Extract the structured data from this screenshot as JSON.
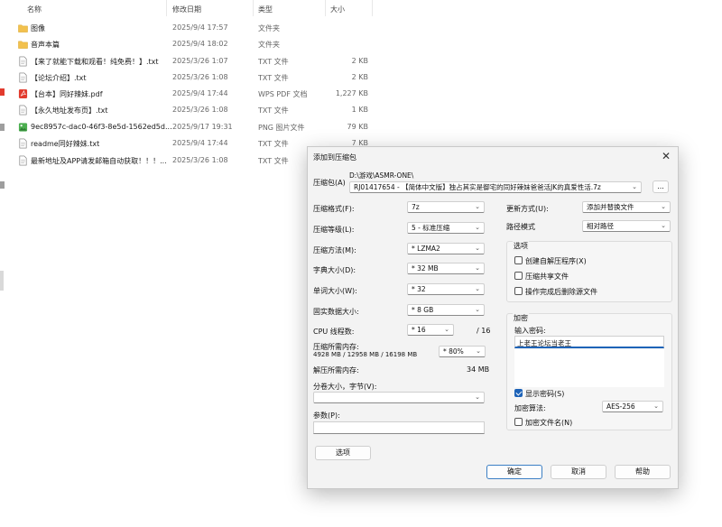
{
  "explorer": {
    "columns": {
      "name": "名称",
      "modified": "修改日期",
      "type": "类型",
      "size": "大小"
    },
    "files": [
      {
        "name": "图像",
        "date": "2025/9/4 17:57",
        "type": "文件夹",
        "size": "",
        "icon": "folder-icon"
      },
      {
        "name": "音声本篇",
        "date": "2025/9/4 18:02",
        "type": "文件夹",
        "size": "",
        "icon": "folder-icon"
      },
      {
        "name": "【来了就能下载和观看！纯免费！】.txt",
        "date": "2025/3/26 1:07",
        "type": "TXT 文件",
        "size": "2 KB",
        "icon": "text-file-icon"
      },
      {
        "name": "【论坛介绍】.txt",
        "date": "2025/3/26 1:08",
        "type": "TXT 文件",
        "size": "2 KB",
        "icon": "text-file-icon"
      },
      {
        "name": "【台本】同好辣妹.pdf",
        "date": "2025/9/4 17:44",
        "type": "WPS PDF 文档",
        "size": "1,227 KB",
        "icon": "pdf-file-icon"
      },
      {
        "name": "【永久地址发布页】.txt",
        "date": "2025/3/26 1:08",
        "type": "TXT 文件",
        "size": "1 KB",
        "icon": "text-file-icon"
      },
      {
        "name": "9ec8957c-dac0-46f3-8e5d-1562ed5d...",
        "date": "2025/9/17 19:31",
        "type": "PNG 图片文件",
        "size": "79 KB",
        "icon": "image-file-icon"
      },
      {
        "name": "readme同好辣妹.txt",
        "date": "2025/9/4 17:44",
        "type": "TXT 文件",
        "size": "7 KB",
        "icon": "text-file-icon"
      },
      {
        "name": "最新地址及APP请发邮箱自动获取！！！...",
        "date": "2025/3/26 1:08",
        "type": "TXT 文件",
        "size": "",
        "icon": "text-file-icon"
      }
    ]
  },
  "dialog": {
    "title": "添加到压缩包",
    "close": "✕",
    "archive": {
      "label": "压缩包(A)",
      "path": "D:\\游戏\\ASMR-ONE\\",
      "filename": "RJ01417654 - 【简体中文版】独占其实是御宅的同好辣妹爸爸活JK的真爱性活.7z",
      "browse": "..."
    },
    "format": {
      "label": "压缩格式(F):",
      "value": "7z"
    },
    "level": {
      "label": "压缩等级(L):",
      "value": "5 - 标准压缩"
    },
    "method": {
      "label": "压缩方法(M):",
      "value": "* LZMA2"
    },
    "dict": {
      "label": "字典大小(D):",
      "value": "* 32 MB"
    },
    "word": {
      "label": "单词大小(W):",
      "value": "* 32"
    },
    "solid": {
      "label": "固实数据大小:",
      "value": "* 8 GB"
    },
    "cpu": {
      "label": "CPU 线程数:",
      "value": "* 16",
      "total": "/ 16"
    },
    "mem_compress": {
      "label": "压缩所需内存:",
      "detail": "4928 MB / 12958 MB / 16198 MB",
      "value": "* 80%"
    },
    "mem_decompress": {
      "label": "解压所需内存:",
      "value": "34 MB"
    },
    "split": {
      "label": "分卷大小，字节(V):",
      "value": ""
    },
    "params": {
      "label": "参数(P):",
      "value": ""
    },
    "options_button": "选项",
    "update_mode": {
      "label": "更新方式(U):",
      "value": "添加并替换文件"
    },
    "path_mode": {
      "label": "路径模式",
      "value": "相对路径"
    },
    "options_group": {
      "title": "选项",
      "items": [
        {
          "label": "创建自解压程序(X)",
          "checked": false
        },
        {
          "label": "压缩共享文件",
          "checked": false
        },
        {
          "label": "操作完成后删除源文件",
          "checked": false
        }
      ]
    },
    "encryption": {
      "title": "加密",
      "password_label": "输入密码:",
      "password_value": "上老王论坛当老王",
      "show_password": {
        "label": "显示密码(S)",
        "checked": true
      },
      "method_label": "加密算法:",
      "method_value": "AES-256",
      "encrypt_names": {
        "label": "加密文件名(N)",
        "checked": false
      }
    },
    "buttons": {
      "ok": "确定",
      "cancel": "取消",
      "help": "帮助"
    }
  }
}
